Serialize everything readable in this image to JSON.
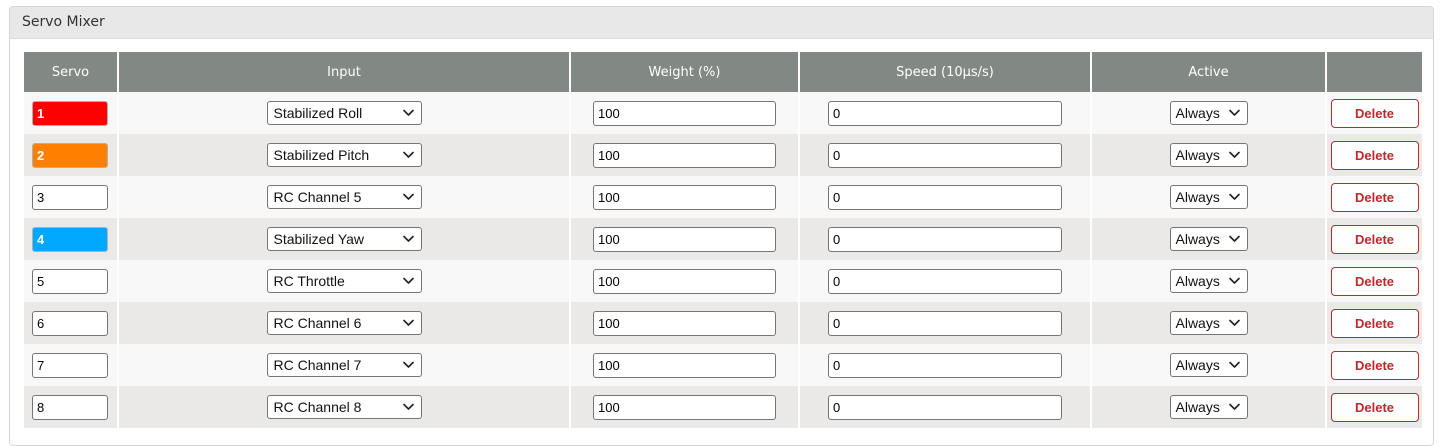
{
  "panel": {
    "title": "Servo Mixer"
  },
  "columns": {
    "servo": "Servo",
    "input": "Input",
    "weight": "Weight (%)",
    "speed": "Speed (10µs/s)",
    "active": "Active",
    "actions": ""
  },
  "rows": [
    {
      "servo": "1",
      "servo_color": "#ff0000",
      "input": "Stabilized Roll",
      "weight": "100",
      "speed": "0",
      "active": "Always",
      "delete_label": "Delete"
    },
    {
      "servo": "2",
      "servo_color": "#ff8000",
      "input": "Stabilized Pitch",
      "weight": "100",
      "speed": "0",
      "active": "Always",
      "delete_label": "Delete"
    },
    {
      "servo": "3",
      "servo_color": "",
      "input": "RC Channel 5",
      "weight": "100",
      "speed": "0",
      "active": "Always",
      "delete_label": "Delete"
    },
    {
      "servo": "4",
      "servo_color": "#00a8ff",
      "input": "Stabilized Yaw",
      "weight": "100",
      "speed": "0",
      "active": "Always",
      "delete_label": "Delete"
    },
    {
      "servo": "5",
      "servo_color": "",
      "input": "RC Throttle",
      "weight": "100",
      "speed": "0",
      "active": "Always",
      "delete_label": "Delete"
    },
    {
      "servo": "6",
      "servo_color": "",
      "input": "RC Channel 6",
      "weight": "100",
      "speed": "0",
      "active": "Always",
      "delete_label": "Delete"
    },
    {
      "servo": "7",
      "servo_color": "",
      "input": "RC Channel 7",
      "weight": "100",
      "speed": "0",
      "active": "Always",
      "delete_label": "Delete"
    },
    {
      "servo": "8",
      "servo_color": "",
      "input": "RC Channel 8",
      "weight": "100",
      "speed": "0",
      "active": "Always",
      "delete_label": "Delete"
    }
  ],
  "icons": {
    "dropdown": "chevron-down-icon"
  },
  "colors": {
    "header_bg": "#828884",
    "delete": "#c0282d",
    "row_odd": "#f8f8f8",
    "row_even": "#ebe8e8"
  }
}
